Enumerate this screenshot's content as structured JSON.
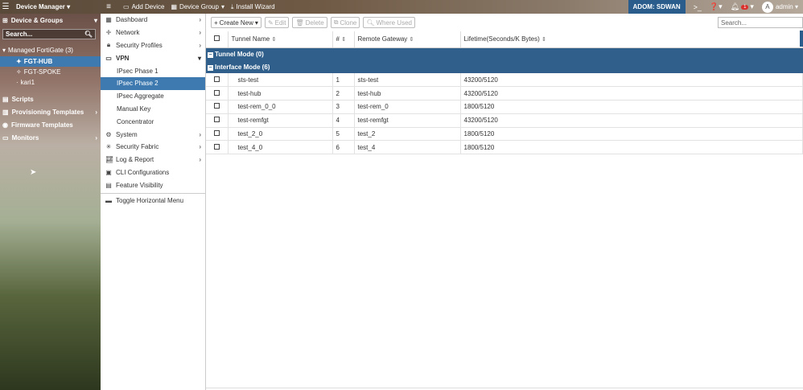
{
  "topbar": {
    "app_title": "Device Manager",
    "add_device": "Add Device",
    "device_group": "Device Group",
    "install_wizard": "Install Wizard",
    "adom": "ADOM: SDWAN",
    "notification_count": "1",
    "avatar_letter": "A",
    "user": "admin"
  },
  "leftnav": {
    "devices_groups": "Device & Groups",
    "search_placeholder": "Search...",
    "managed_header": "Managed FortiGate (3)",
    "devices": [
      "FGT-HUB",
      "FGT-SPOKE",
      "kari1"
    ],
    "scripts": "Scripts",
    "provisioning": "Provisioning Templates",
    "firmware": "Firmware Templates",
    "monitors": "Monitors"
  },
  "menu": {
    "dashboard": "Dashboard",
    "network": "Network",
    "security_profiles": "Security Profiles",
    "vpn": "VPN",
    "vpn_items": [
      "IPsec Phase 1",
      "IPsec Phase 2",
      "IPsec Aggregate",
      "Manual Key",
      "Concentrator"
    ],
    "system": "System",
    "security_fabric": "Security Fabric",
    "log_report": "Log & Report",
    "cli_configurations": "CLI Configurations",
    "feature_visibility": "Feature Visibility",
    "toggle_horizontal": "Toggle Horizontal Menu"
  },
  "toolbar": {
    "create_new": "Create New",
    "edit": "Edit",
    "delete": "Delete",
    "clone": "Clone",
    "where_used": "Where Used",
    "search_placeholder": "Search..."
  },
  "table": {
    "headers": [
      "Tunnel Name",
      "#",
      "Remote Gateway",
      "Lifetime(Seconds/K Bytes)"
    ],
    "group_tunnel": "Tunnel Mode (0)",
    "group_interface": "Interface Mode (6)",
    "rows": [
      {
        "name": "sts-test",
        "num": "1",
        "gateway": "sts-test",
        "lifetime": "43200/5120"
      },
      {
        "name": "test-hub",
        "num": "2",
        "gateway": "test-hub",
        "lifetime": "43200/5120"
      },
      {
        "name": "test-rem_0_0",
        "num": "3",
        "gateway": "test-rem_0",
        "lifetime": "1800/5120"
      },
      {
        "name": "test-remfgt",
        "num": "4",
        "gateway": "test-remfgt",
        "lifetime": "43200/5120"
      },
      {
        "name": "test_2_0",
        "num": "5",
        "gateway": "test_2",
        "lifetime": "1800/5120"
      },
      {
        "name": "test_4_0",
        "num": "6",
        "gateway": "test_4",
        "lifetime": "1800/5120"
      }
    ]
  },
  "colors": {
    "accent": "#3e7ab0",
    "group_bar": "#2f5f8a",
    "adom_bg": "#2a5d8c"
  }
}
